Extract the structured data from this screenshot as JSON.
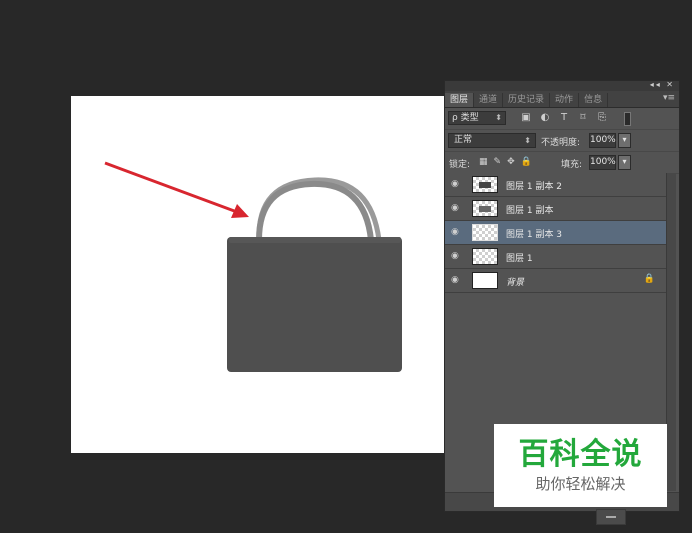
{
  "panel": {
    "window_controls": "◂◂ ✕",
    "tabs": [
      "图层",
      "通道",
      "历史记录",
      "动作",
      "信息"
    ],
    "menu_icon": "▾≡",
    "filter": {
      "label": "ρ 类型",
      "icons": [
        "image-filter-icon",
        "adjustment-filter-icon",
        "type-filter-icon",
        "shape-filter-icon",
        "smart-object-filter-icon"
      ],
      "icon_glyphs": [
        "▣",
        "◐",
        "T",
        "⌑",
        "⎘"
      ]
    },
    "blend_mode": "正常",
    "opacity_label": "不透明度:",
    "opacity_value": "100%",
    "lock_label": "锁定:",
    "lock_glyphs": [
      "▦",
      "✎",
      "✥",
      "🔒"
    ],
    "fill_label": "填充:",
    "fill_value": "100%",
    "layers": [
      {
        "name": "图层 1 副本 2",
        "selected": false
      },
      {
        "name": "图层 1 副本",
        "selected": false
      },
      {
        "name": "图层 1 副本 3",
        "selected": true
      },
      {
        "name": "图层 1",
        "selected": false
      },
      {
        "name": "背景",
        "selected": false,
        "locked": true
      }
    ]
  },
  "watermark": {
    "title": "百科全说",
    "subtitle": "助你轻松解决",
    "color": "#23a83b"
  },
  "colors": {
    "arrow": "#d8262f",
    "bag_body": "#4f4f4f",
    "bag_handle": "#8a8a8a",
    "selection": "#5a6b7e"
  }
}
